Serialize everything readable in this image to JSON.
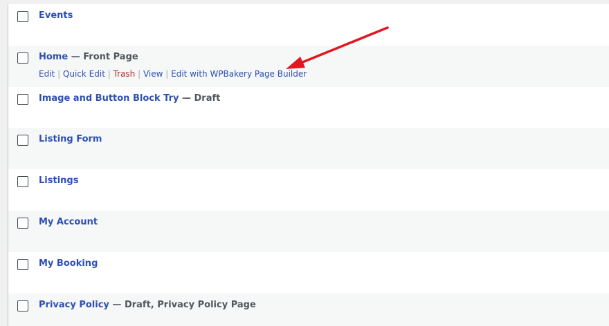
{
  "rows": [
    {
      "title": "Events",
      "state": ""
    },
    {
      "title": "Home",
      "state": " — Front Page"
    },
    {
      "title": "Image and Button Block Try",
      "state": " — Draft"
    },
    {
      "title": "Listing Form",
      "state": ""
    },
    {
      "title": "Listings",
      "state": ""
    },
    {
      "title": "My Account",
      "state": ""
    },
    {
      "title": "My Booking",
      "state": ""
    },
    {
      "title": "Privacy Policy",
      "state": " — Draft, Privacy Policy Page"
    }
  ],
  "row_actions": {
    "edit": "Edit",
    "quick_edit": "Quick Edit",
    "trash": "Trash",
    "view": "View",
    "wpbakery": "Edit with WPBakery Page Builder",
    "separator": " | "
  },
  "colors": {
    "link": "#2d4fb5",
    "trash": "#b32d2e",
    "state_text": "#50575e",
    "alt_row": "#f6f7f7",
    "annotation_arrow": "#e0171f"
  }
}
